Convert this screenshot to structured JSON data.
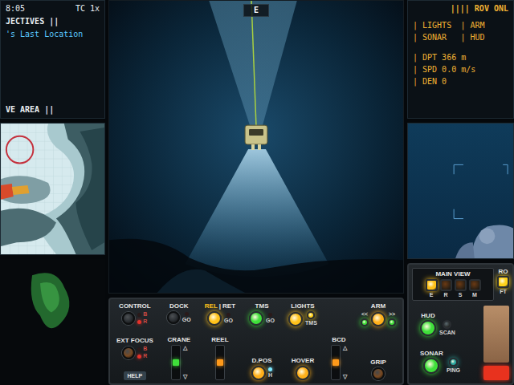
{
  "left_panel": {
    "clock": "8:05",
    "time_label": "TC",
    "time_scale": "1x",
    "objectives_title": "JECTIVES ||",
    "objectives": [
      "'s Last Location"
    ],
    "area_title": "VE AREA ||"
  },
  "camera": {
    "heading": "E"
  },
  "status": {
    "title": "|||| ROV ONL",
    "systems": [
      "| LIGHTS",
      "| ARM",
      "| SONAR",
      "| HUD"
    ],
    "readings": [
      "| DPT 366 m",
      "| SPD 0.0 m/s",
      "| DEN 0"
    ]
  },
  "control_panel": {
    "columns": [
      {
        "items": [
          {
            "kind": "knob",
            "label": "CONTROL",
            "color": "#2c3034",
            "leds": [
              {
                "label": "B",
                "on": false,
                "color": "#3b6fd6"
              },
              {
                "label": "R",
                "on": true,
                "color": "#e5322b"
              }
            ]
          },
          {
            "kind": "knob",
            "label": "EXT FOCUS",
            "color": "#7a4a22",
            "leds": [
              {
                "label": "B",
                "on": false,
                "color": "#3b6fd6"
              },
              {
                "label": "R",
                "on": true,
                "color": "#e5322b"
              }
            ]
          },
          {
            "kind": "tab",
            "label": "HELP"
          }
        ]
      },
      {
        "items": [
          {
            "kind": "knob",
            "label": "DOCK",
            "color": "#2c3034",
            "tag": {
              "label": "GO",
              "on": false,
              "color": "#e5322b"
            }
          },
          {
            "kind": "slider",
            "label": "CRANE",
            "level": 0.5,
            "color": "#3fe03a",
            "arrows": [
              "△",
              "▽"
            ]
          }
        ]
      },
      {
        "items": [
          {
            "kind": "toggle",
            "options": [
              {
                "label": "REL",
                "selected": true
              },
              {
                "label": "RET",
                "selected": false
              }
            ],
            "separator": "|",
            "lit": true,
            "color": "#ffc21a",
            "tag": {
              "label": "GO",
              "on": false,
              "color": "#e5322b"
            }
          },
          {
            "kind": "slider",
            "label": "REEL",
            "level": 0.5,
            "color": "#ff9a1a",
            "arrows": []
          }
        ]
      },
      {
        "items": [
          {
            "kind": "button",
            "label": "TMS",
            "lit": true,
            "color": "#3fe03a",
            "tag": {
              "label": "GO",
              "on": false,
              "color": "#e5322b"
            }
          },
          {
            "kind": "button",
            "label": "D.POS",
            "lit": true,
            "color": "#ffb01a",
            "tag": {
              "label": "H",
              "on": true,
              "color": "#7fe8ff"
            }
          }
        ]
      },
      {
        "items": [
          {
            "kind": "button",
            "label": "LIGHTS",
            "lit": true,
            "color": "#ffc21a",
            "small": {
              "label": "TMS",
              "lit": true,
              "color": "#ffd21a"
            }
          },
          {
            "kind": "button",
            "label": "HOVER",
            "lit": true,
            "color": "#ffb01a"
          }
        ]
      },
      {
        "items": [
          {
            "kind": "slider",
            "label": "BCD",
            "level": 0.5,
            "color": "#ff9a1a",
            "arrows": [
              "△",
              "▽"
            ]
          }
        ]
      },
      {
        "items": [
          {
            "kind": "button",
            "label": "ARM",
            "lit": true,
            "color": "#ffb01a",
            "sides": [
              {
                "label": "<<",
                "lit": true,
                "color": "#3fe03a"
              },
              {
                "label": ">>",
                "lit": true,
                "color": "#3fe03a"
              }
            ]
          },
          {
            "kind": "knob",
            "label": "GRIP",
            "color": "#7a4a22"
          }
        ]
      }
    ]
  },
  "side_panel": {
    "view": {
      "label": "MAIN VIEW",
      "options": [
        {
          "label": "E",
          "selected": true
        },
        {
          "label": "R",
          "selected": false
        },
        {
          "label": "S",
          "selected": false
        },
        {
          "label": "M",
          "selected": false
        }
      ]
    },
    "rotate": {
      "label": "RO",
      "button": "FT",
      "lit": true
    },
    "toggles": [
      {
        "label": "HUD",
        "lit": true,
        "extra": {
          "label": "SCAN",
          "lit": false,
          "color": "#5a6a70"
        }
      },
      {
        "label": "SONAR",
        "lit": true,
        "extra": {
          "label": "PING",
          "lit": true,
          "color": "#2aa8a0"
        }
      }
    ],
    "alarm": {
      "lit": true
    }
  }
}
